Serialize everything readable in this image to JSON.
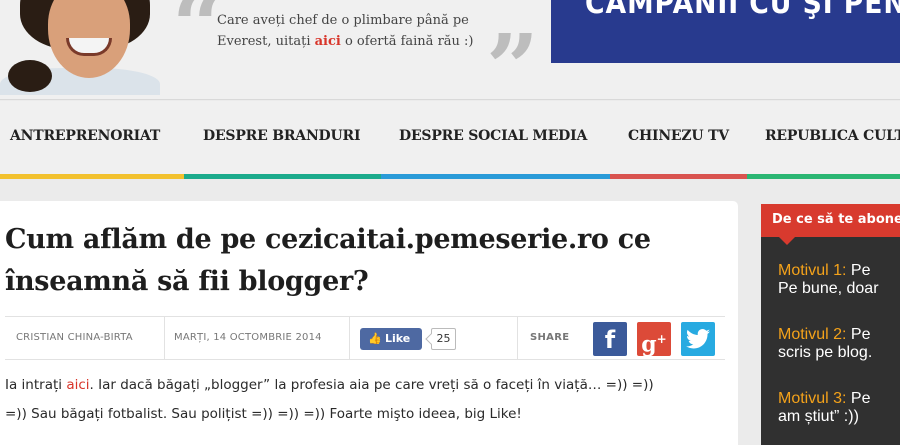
{
  "header": {
    "tagline_before": "Care aveți chef de o plimbare până pe Everest, uitați ",
    "tagline_link": "aici",
    "tagline_after": " o ofertă faină rău :)",
    "quote_open": "“",
    "quote_close": "”",
    "banner_text": "CAMPANII CU ŞI PENTRU"
  },
  "nav": {
    "items": [
      {
        "label": "ANTREPRENORIAT",
        "color": "#f2c12e"
      },
      {
        "label": "DESPRE BRANDURI",
        "color": "#1cab8c"
      },
      {
        "label": "DESPRE SOCIAL MEDIA",
        "color": "#2a9bd8"
      },
      {
        "label": "CHINEZU TV",
        "color": "#d9534f"
      },
      {
        "label": "REPUBLICA CULTURALĂ",
        "color": "#2bb673"
      }
    ]
  },
  "article": {
    "title": "Cum aflăm de pe cezicaitai.pemeserie.ro ce înseamnă să fii blogger?",
    "author": "CRISTIAN CHINA-BIRTA",
    "date": "MARȚI, 14 OCTOMBRIE 2014",
    "like_label": "Like",
    "like_count": "25",
    "share_label": "SHARE",
    "body_p1_before": "Ia intrați ",
    "body_p1_link": "aici",
    "body_p1_after": ". Iar dacă băgați „blogger” la profesia aia pe care vreți să o faceți în viață… =)) =))",
    "body_p2": "=)) Sau băgați fotbalist. Sau polițist =)) =)) =)) Foarte mişto ideea, big Like!"
  },
  "sidebar": {
    "heading": "De ce să te abonezi",
    "reasons": [
      {
        "key": "Motivul 1:",
        "line1": " Pe",
        "line2": "Pe bune, doar"
      },
      {
        "key": "Motivul 2:",
        "line1": " Pe",
        "line2": "scris pe blog."
      },
      {
        "key": "Motivul 3:",
        "line1": " Pe",
        "line2": "am știut” :))"
      }
    ]
  },
  "icons": {
    "facebook": "facebook-icon",
    "googleplus": "google-plus-icon",
    "twitter": "twitter-icon",
    "like_thumb": "thumbs-up-icon"
  }
}
